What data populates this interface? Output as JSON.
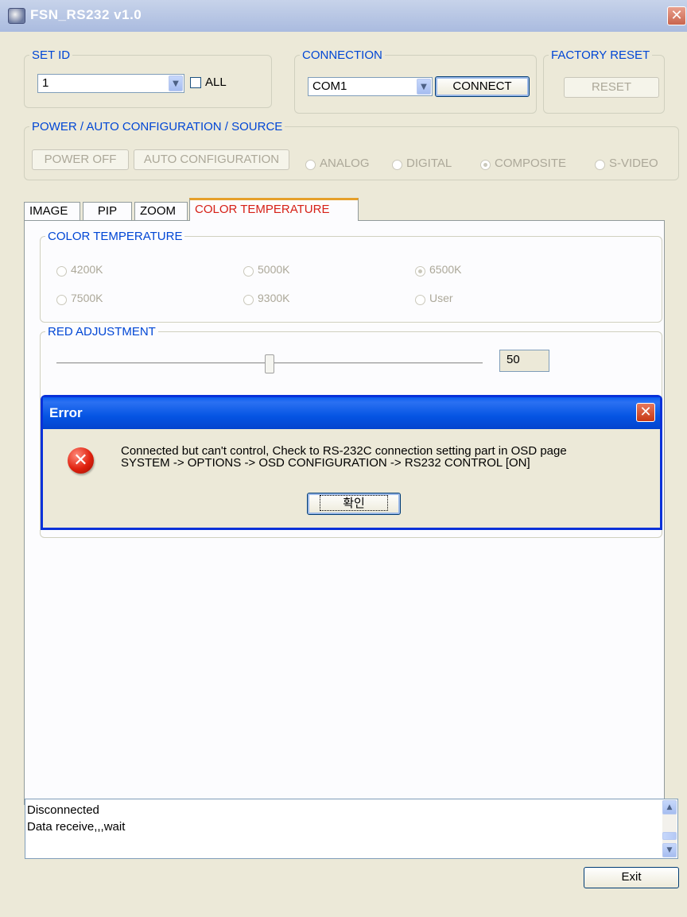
{
  "window": {
    "title": "FSN_RS232 v1.0",
    "close_glyph": "✕"
  },
  "set_id": {
    "legend": "SET ID",
    "value": "1",
    "all_label": "ALL"
  },
  "connection": {
    "legend": "CONNECTION",
    "port": "COM1",
    "connect_label": "CONNECT"
  },
  "factory_reset": {
    "legend": "FACTORY RESET",
    "reset_label": "RESET"
  },
  "power": {
    "legend": "POWER / AUTO CONFIGURATION / SOURCE",
    "power_off_label": "POWER OFF",
    "auto_config_label": "AUTO CONFIGURATION",
    "sources": [
      "ANALOG",
      "DIGITAL",
      "COMPOSITE",
      "S-VIDEO"
    ],
    "selected_source": "COMPOSITE"
  },
  "tabs": [
    "IMAGE",
    "PIP",
    "ZOOM",
    "COLOR TEMPERATURE"
  ],
  "active_tab": "COLOR TEMPERATURE",
  "color_temperature": {
    "legend": "COLOR TEMPERATURE",
    "options": [
      "4200K",
      "5000K",
      "6500K",
      "7500K",
      "9300K",
      "User"
    ],
    "selected": "6500K"
  },
  "red_adjustment": {
    "legend": "RED ADJUSTMENT",
    "value": "50",
    "fraction": 0.5
  },
  "error_dialog": {
    "title": "Error",
    "line1": "Connected but can't control, Check to RS-232C connection setting part in OSD page",
    "line2": "SYSTEM -> OPTIONS -> OSD CONFIGURATION -> RS232 CONTROL [ON]",
    "ok_label": "확인",
    "close_glyph": "✕",
    "icon_glyph": "✕"
  },
  "log": {
    "lines": [
      "Disconnected",
      "Data receive,,,wait"
    ]
  },
  "exit_label": "Exit",
  "colors": {
    "legend_blue": "#0046d5",
    "active_tab_red": "#d62016",
    "dialog_blue": "#0831d9",
    "disabled_gray": "#aca899"
  }
}
